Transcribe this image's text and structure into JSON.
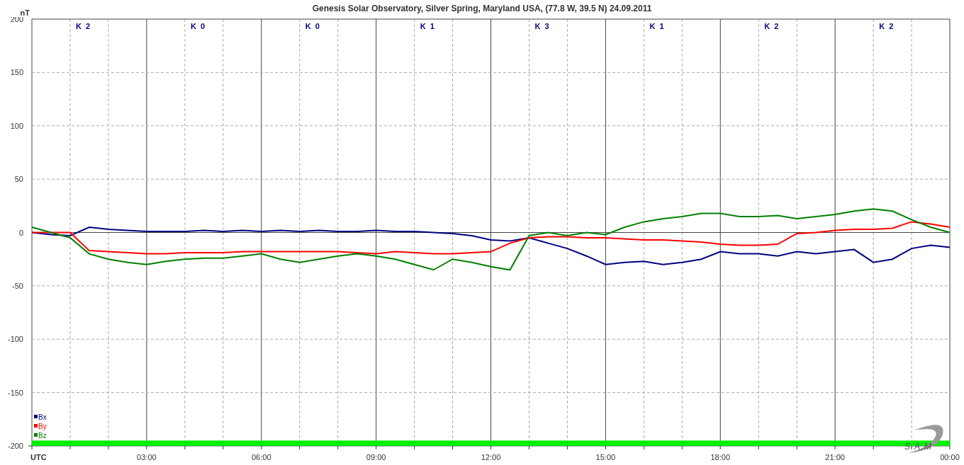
{
  "title": "Genesis Solar Observatory, Silver Spring, Maryland USA, (77.8 W, 39.5 N)  24.09.2011",
  "k_indices": [
    "K 2",
    "K 0",
    "K 0",
    "K 1",
    "K 3",
    "K 1",
    "K 2",
    "K 2"
  ],
  "logo": {
    "text": "SAM"
  },
  "chart_data": {
    "type": "line",
    "ylabel": "nT",
    "xlim": [
      0,
      24
    ],
    "ylim": [
      -200,
      200
    ],
    "grid": true,
    "legend": "lower left",
    "bands": [
      {
        "axis": "y",
        "from": -200,
        "to": -195,
        "color": "#00ee00"
      }
    ],
    "yticks": [
      200,
      150,
      100,
      50,
      0,
      -50,
      -100,
      -150,
      -200
    ],
    "xticks": [
      {
        "value": 0,
        "label": "UTC"
      },
      {
        "value": 3,
        "label": "03:00"
      },
      {
        "value": 6,
        "label": "06:00"
      },
      {
        "value": 9,
        "label": "09:00"
      },
      {
        "value": 12,
        "label": "12:00"
      },
      {
        "value": 15,
        "label": "15:00"
      },
      {
        "value": 18,
        "label": "18:00"
      },
      {
        "value": 21,
        "label": "21:00"
      },
      {
        "value": 24,
        "label": "00:00"
      }
    ],
    "x": [
      0,
      0.5,
      1,
      1.5,
      2,
      2.5,
      3,
      3.5,
      4,
      4.5,
      5,
      5.5,
      6,
      6.5,
      7,
      7.5,
      8,
      8.5,
      9,
      9.5,
      10,
      10.5,
      11,
      11.5,
      12,
      12.5,
      13,
      13.5,
      14,
      14.5,
      15,
      15.5,
      16,
      16.5,
      17,
      17.5,
      18,
      18.5,
      19,
      19.5,
      20,
      20.5,
      21,
      21.5,
      22,
      22.5,
      23,
      23.5,
      24
    ],
    "series": [
      {
        "name": "Bx",
        "color": "#000080",
        "values": [
          0,
          -2,
          -3,
          5,
          3,
          2,
          1,
          1,
          1,
          2,
          1,
          2,
          1,
          2,
          1,
          2,
          1,
          1,
          2,
          1,
          1,
          0,
          -1,
          -3,
          -7,
          -8,
          -5,
          -10,
          -15,
          -22,
          -30,
          -28,
          -27,
          -30,
          -28,
          -25,
          -18,
          -20,
          -20,
          -22,
          -18,
          -20,
          -18,
          -16,
          -28,
          -25,
          -15,
          -12,
          -14
        ]
      },
      {
        "name": "By",
        "color": "#ff0000",
        "values": [
          0,
          0,
          0,
          -17,
          -18,
          -19,
          -20,
          -20,
          -19,
          -19,
          -19,
          -18,
          -18,
          -18,
          -18,
          -18,
          -18,
          -19,
          -20,
          -18,
          -19,
          -20,
          -20,
          -19,
          -18,
          -10,
          -5,
          -4,
          -4,
          -5,
          -5,
          -6,
          -7,
          -7,
          -8,
          -9,
          -11,
          -12,
          -12,
          -11,
          -1,
          0,
          2,
          3,
          3,
          4,
          10,
          8,
          5
        ]
      },
      {
        "name": "Bz",
        "color": "#008000",
        "values": [
          5,
          0,
          -5,
          -20,
          -25,
          -28,
          -30,
          -27,
          -25,
          -24,
          -24,
          -22,
          -20,
          -25,
          -28,
          -25,
          -22,
          -20,
          -22,
          -25,
          -30,
          -35,
          -25,
          -28,
          -32,
          -35,
          -3,
          0,
          -3,
          0,
          -2,
          5,
          10,
          13,
          15,
          18,
          18,
          15,
          15,
          16,
          13,
          15,
          17,
          20,
          22,
          20,
          12,
          5,
          0
        ]
      }
    ]
  }
}
